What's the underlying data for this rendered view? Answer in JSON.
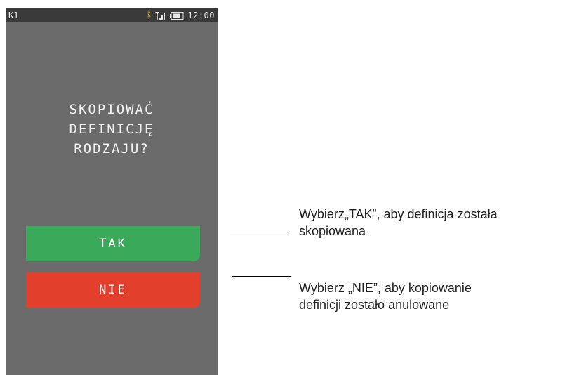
{
  "status_bar": {
    "terminal_id": "K1",
    "time": "12:00",
    "icons": [
      "bluetooth-icon",
      "signal-icon",
      "battery-icon"
    ]
  },
  "dialog": {
    "prompt_lines": [
      "SKOPIOWAĆ",
      "DEFINICJĘ",
      "RODZAJU?"
    ],
    "yes_label": "TAK",
    "no_label": "NIE"
  },
  "annotations": {
    "yes": {
      "line1": "Wybierz„TAK”, aby definicja została",
      "line2": "skopiowana"
    },
    "no": {
      "line1": "Wybierz „NIE”, aby kopiowanie",
      "line2": "definicji zostało anulowane"
    }
  },
  "colors": {
    "screen_bg": "#6b6b6b",
    "status_bar_bg": "#3a3a3a",
    "yes_button": "#3aaa5a",
    "no_button": "#e2402c",
    "bluetooth": "#f2c200"
  }
}
